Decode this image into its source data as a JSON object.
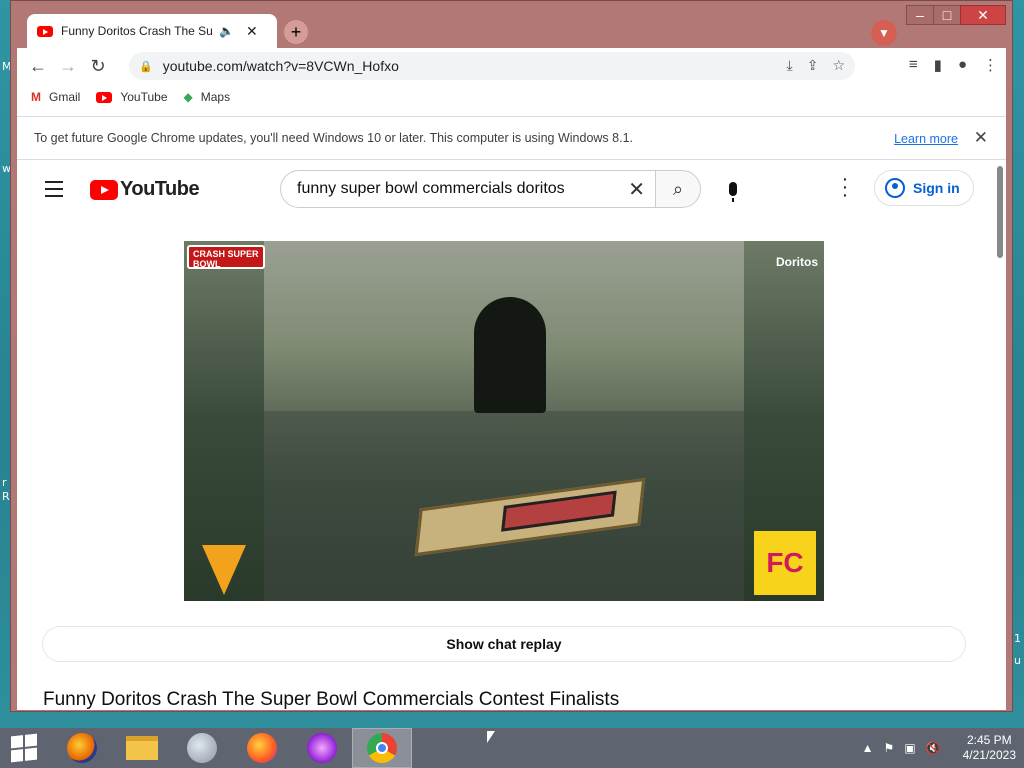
{
  "tab": {
    "title": "Funny Doritos Crash The Super Bowl Commercials Contest Finalists"
  },
  "omnibox": {
    "url": "youtube.com/watch?v=8VCWn_Hofxo"
  },
  "bookmarks": [
    {
      "label": "Gmail"
    },
    {
      "label": "YouTube"
    },
    {
      "label": "Maps"
    }
  ],
  "infobar": {
    "message": "To get future Google Chrome updates, you'll need Windows 10 or later. This computer is using Windows 8.1.",
    "link": "Learn more"
  },
  "youtube": {
    "logo": "YouTube",
    "search_value": "funny super bowl commercials doritos",
    "signin": "Sign in",
    "chat_replay": "Show chat replay",
    "video_title": "Funny Doritos Crash The Super Bowl Commercials Contest Finalists"
  },
  "video_overlay": {
    "left_logo": "CRASH SUPER BOWL",
    "right_logo": "Doritos",
    "fc_logo": "FC"
  },
  "taskbar": {
    "time": "2:45 PM",
    "date": "4/21/2023",
    "apps": [
      "firefox",
      "file-explorer",
      "thunderbird",
      "firefox-alt",
      "ie-mask",
      "chrome"
    ]
  },
  "colors": {
    "titlebar": "#b27876",
    "yt_red": "#ff0000",
    "link_blue": "#1a73e8",
    "taskbar": "#5f6570"
  }
}
